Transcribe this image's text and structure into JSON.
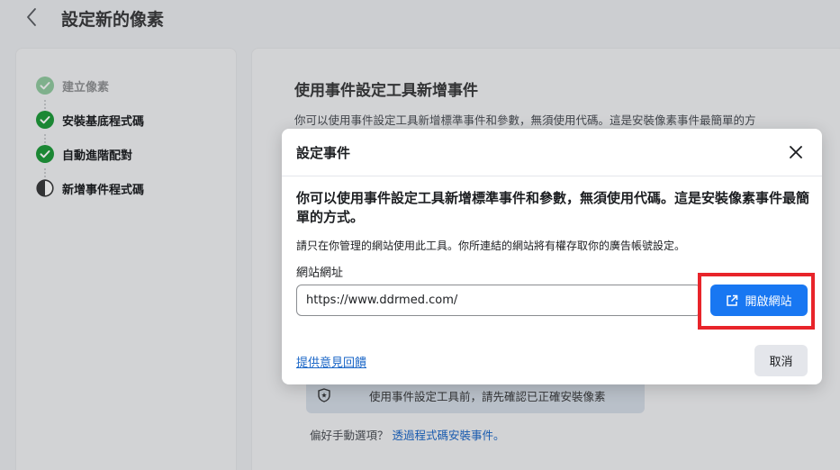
{
  "header": {
    "title": "設定新的像素"
  },
  "steps": [
    {
      "label": "建立像素",
      "state": "done-faded"
    },
    {
      "label": "安裝基底程式碼",
      "state": "done"
    },
    {
      "label": "自動進階配對",
      "state": "done"
    },
    {
      "label": "新增事件程式碼",
      "state": "in-progress"
    }
  ],
  "content": {
    "title": "使用事件設定工具新增事件",
    "description": "你可以使用事件設定工具新增標準事件和參數，無須使用代碼。這是安裝像素事件最簡單的方",
    "notice": "使用事件設定工具前，請先確認已正確安裝像素",
    "manual_prefix": "偏好手動選項？",
    "manual_link": "透過程式碼安裝事件。"
  },
  "modal": {
    "title": "設定事件",
    "heading": "你可以使用事件設定工具新增標準事件和參數，無須使用代碼。這是安裝像素事件最簡單的方式。",
    "note": "請只在你管理的網站使用此工具。你所連結的網站將有權存取你的廣告帳號設定。",
    "field_label": "網站網址",
    "url_value": "https://www.ddrmed.com/",
    "open_button": "開啟網站",
    "feedback_link": "提供意見回饋",
    "cancel_button": "取消"
  },
  "colors": {
    "accent": "#1877f2",
    "success": "#1f9a3c",
    "highlight": "#e8242a",
    "link": "#1a66c7"
  },
  "icons": [
    "back-chevron-icon",
    "check-circle-icon",
    "half-circle-icon",
    "shield-icon",
    "close-icon",
    "external-link-icon"
  ]
}
